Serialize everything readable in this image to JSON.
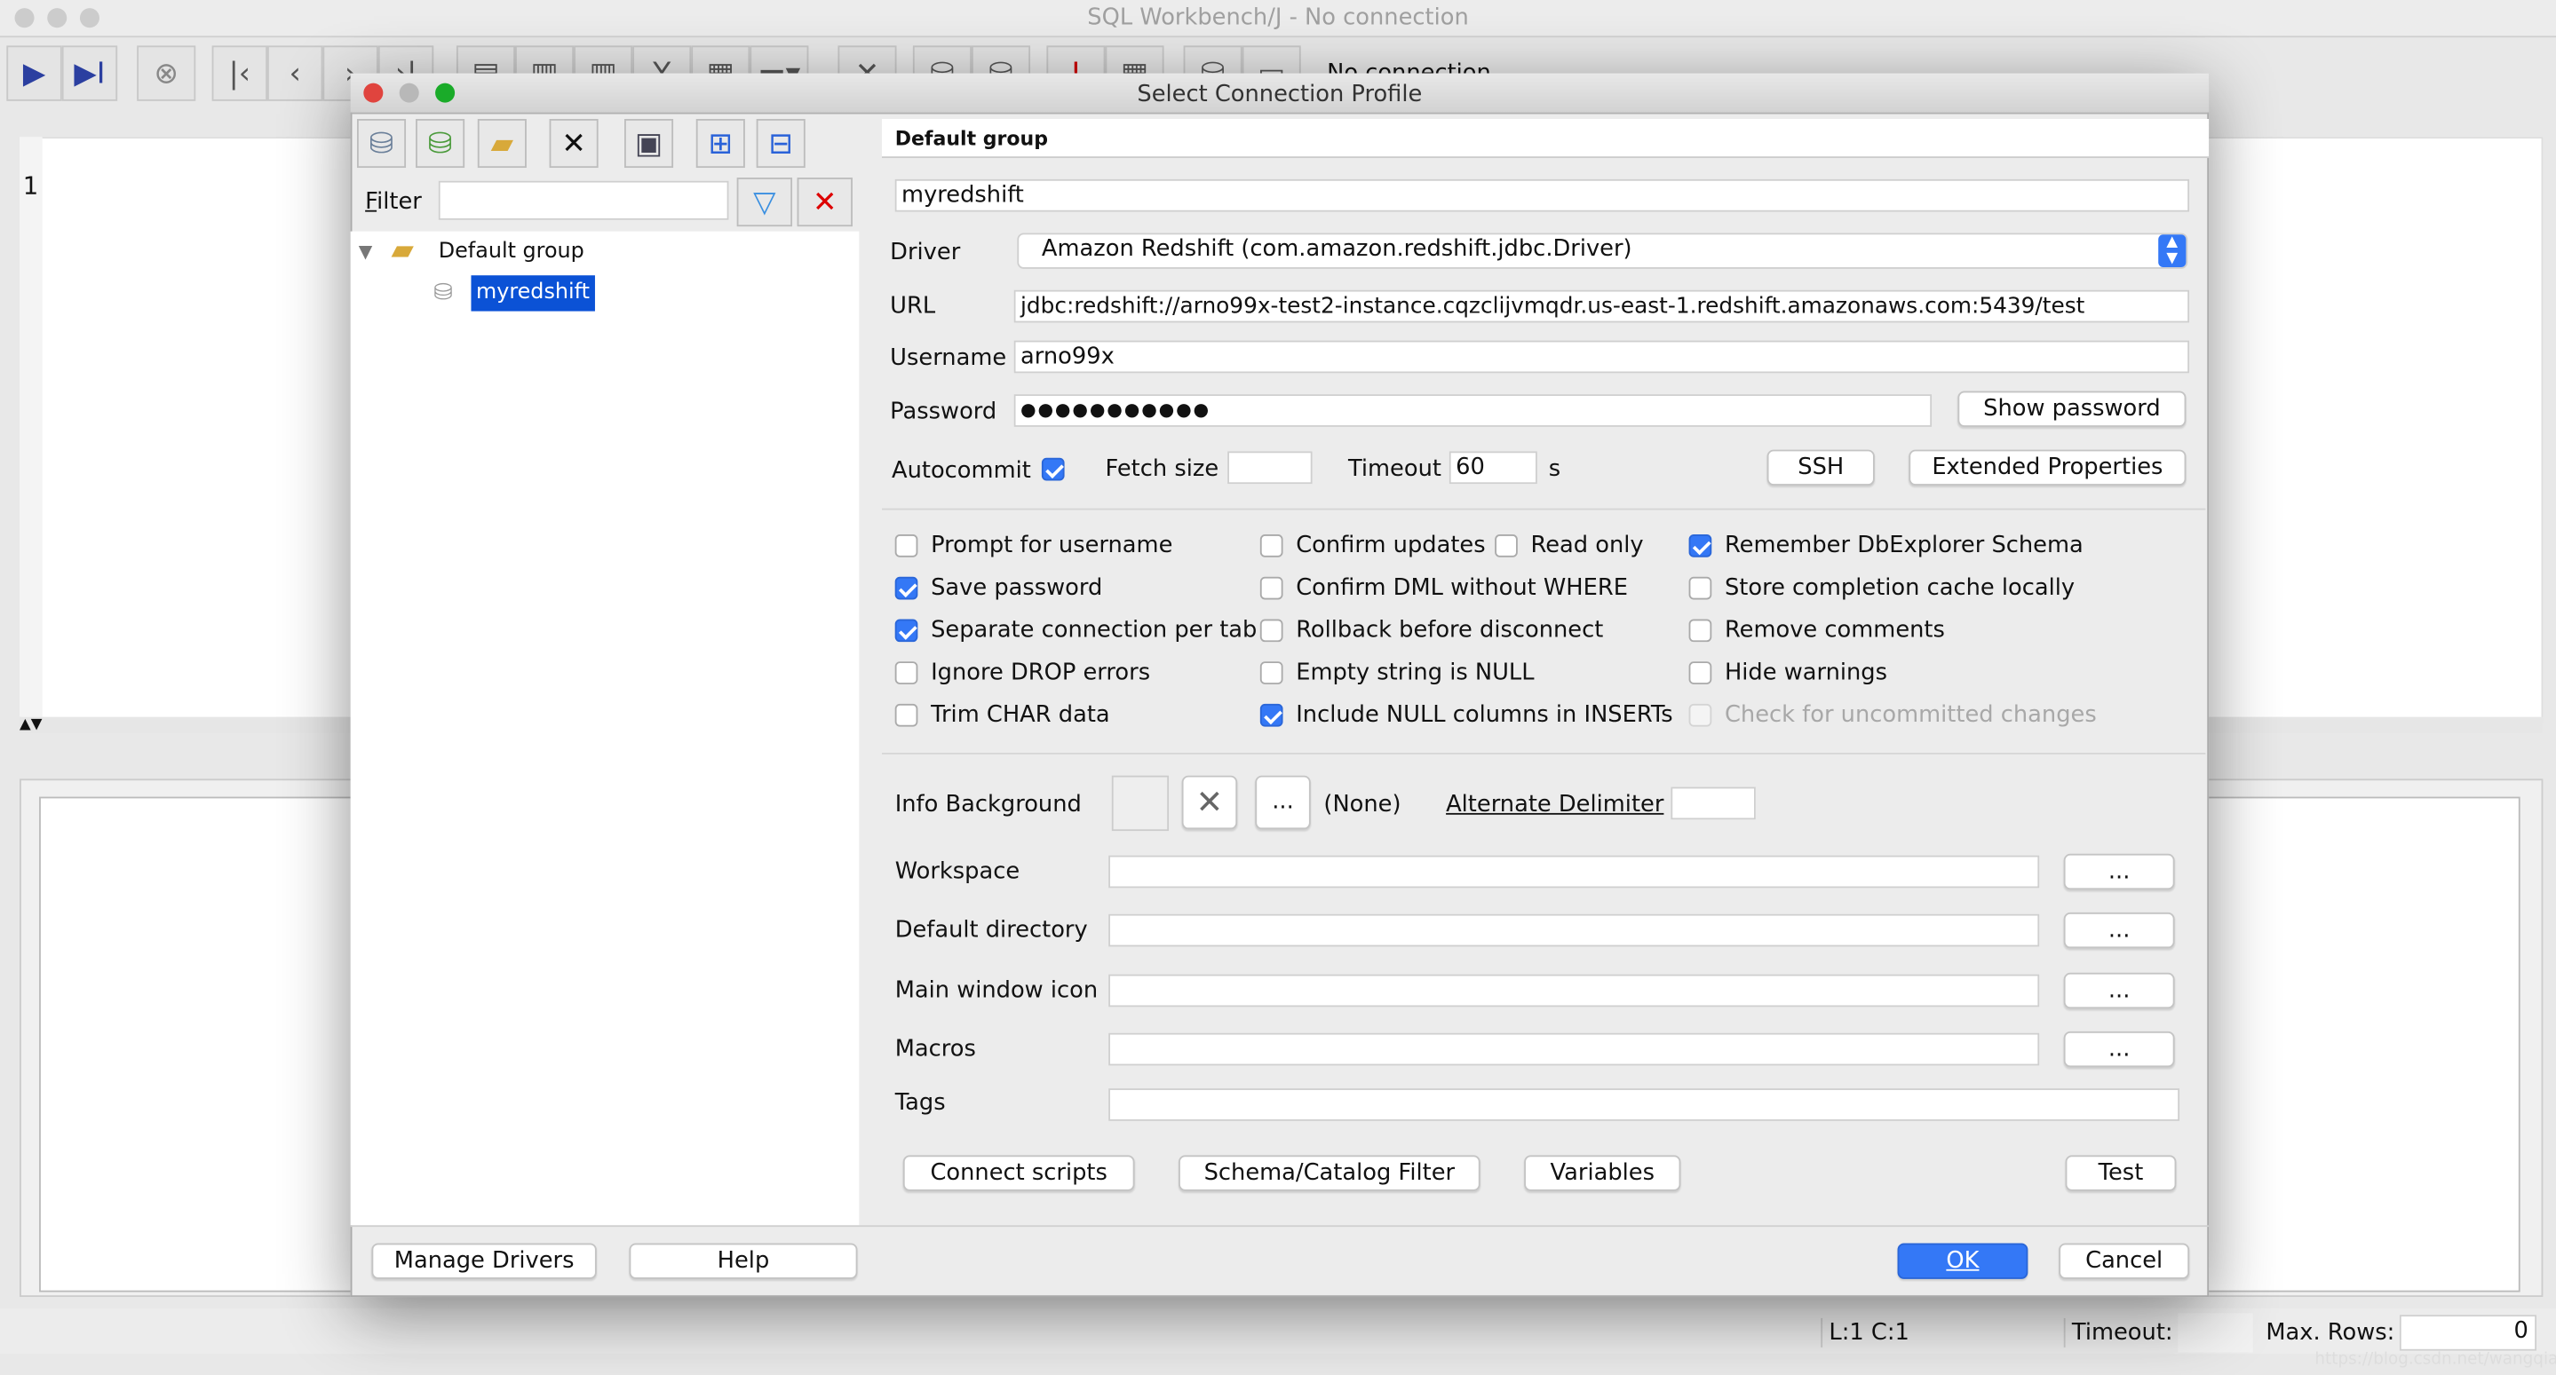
{
  "main_window": {
    "title": "SQL Workbench/J - No connection",
    "connection_status": "No connection",
    "editor_line_number": "1",
    "status_bar": {
      "position": "L:1 C:1",
      "timeout_label": "Timeout:",
      "timeout_value": "",
      "max_rows_label": "Max. Rows:",
      "max_rows_value": "0"
    },
    "watermark": "https://blog.csdn.net/wangqiang9x"
  },
  "dialog": {
    "title": "Select Connection Profile",
    "filter_label": "Filter",
    "filter_value": "",
    "tree": {
      "group": "Default group",
      "profiles": [
        "myredshift"
      ]
    },
    "group_header": "Default group",
    "profile_name": "myredshift",
    "driver_label": "Driver",
    "driver_value": "Amazon Redshift (com.amazon.redshift.jdbc.Driver)",
    "url_label": "URL",
    "url_value": "jdbc:redshift://arno99x-test2-instance.cqzclijvmqdr.us-east-1.redshift.amazonaws.com:5439/test",
    "username_label": "Username",
    "username_value": "arno99x",
    "password_label": "Password",
    "password_value": "●●●●●●●●●●●",
    "show_password": "Show password",
    "autocommit_label": "Autocommit",
    "autocommit": true,
    "fetch_size_label": "Fetch size",
    "fetch_size_value": "",
    "timeout_label": "Timeout",
    "timeout_value": "60",
    "timeout_unit": "s",
    "ssh": "SSH",
    "extended_properties": "Extended Properties",
    "options": [
      {
        "label": "Prompt for username",
        "checked": false
      },
      {
        "label": "Save password",
        "checked": true
      },
      {
        "label": "Separate connection per tab",
        "checked": true
      },
      {
        "label": "Ignore DROP errors",
        "checked": false
      },
      {
        "label": "Trim CHAR data",
        "checked": false
      },
      {
        "label": "Confirm updates",
        "checked": false
      },
      {
        "label": "Read only",
        "checked": false
      },
      {
        "label": "Confirm DML without WHERE",
        "checked": false
      },
      {
        "label": "Rollback before disconnect",
        "checked": false
      },
      {
        "label": "Empty string is NULL",
        "checked": false
      },
      {
        "label": "Include NULL columns in INSERTs",
        "checked": true
      },
      {
        "label": "Remember DbExplorer Schema",
        "checked": true
      },
      {
        "label": "Store completion cache locally",
        "checked": false
      },
      {
        "label": "Remove comments",
        "checked": false
      },
      {
        "label": "Hide warnings",
        "checked": false
      },
      {
        "label": "Check for uncommitted changes",
        "checked": false,
        "disabled": true
      }
    ],
    "info_background_label": "Info Background",
    "info_background_value": "(None)",
    "ellipsis": "...",
    "alternate_delimiter_label": "Alternate Delimiter",
    "alternate_delimiter_value": "",
    "workspace_label": "Workspace",
    "default_directory_label": "Default directory",
    "main_window_icon_label": "Main window icon",
    "macros_label": "Macros",
    "tags_label": "Tags",
    "connect_scripts": "Connect scripts",
    "schema_filter": "Schema/Catalog Filter",
    "variables": "Variables",
    "test": "Test",
    "manage_drivers": "Manage Drivers",
    "help": "Help",
    "ok": "OK",
    "cancel": "Cancel"
  },
  "colors": {
    "accent": "#3478f6",
    "selection": "#0b52d6",
    "close": "#e0443e",
    "minimize": "#dea123",
    "zoom": "#1aab29"
  }
}
